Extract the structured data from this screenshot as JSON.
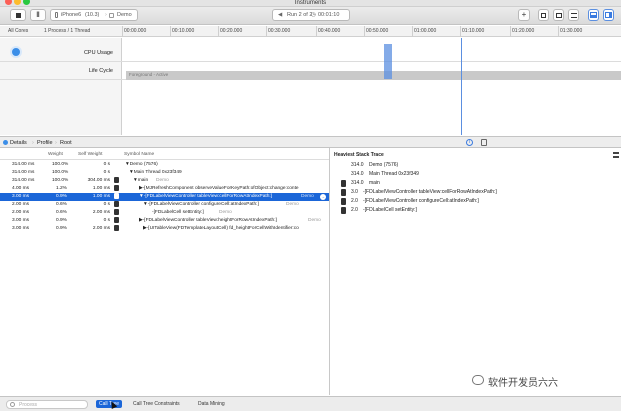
{
  "window": {
    "title": "Instruments"
  },
  "toolbar": {
    "device": "iPhone6",
    "device_version": "(10.3)",
    "target": "Demo",
    "run_label": "Run 2 of 2",
    "run_time": "00:01:10",
    "add_icon": "+"
  },
  "scope": {
    "cores": "All Cores",
    "processes": "1 Process / 1 Thread",
    "ticks": [
      "00:00.000",
      "00:10.000",
      "00:20.000",
      "00:30.000",
      "00:40.000",
      "00:50.000",
      "01:00.000",
      "01:10.000",
      "01:20.000",
      "01:30.000"
    ]
  },
  "tracks": {
    "cpu_label": "CPU Usage",
    "lifecycle_label": "Life Cycle",
    "lifecycle_bar_text": "Foreground - Active"
  },
  "detail": {
    "tab_details": "Details",
    "tab_profile": "Profile",
    "tab_root": "Root"
  },
  "calltree": {
    "headers": {
      "weight": "Weight",
      "self_weight": "Self Weight",
      "symbol": "Symbol Name"
    },
    "rows": [
      {
        "ms": "314.00 ms",
        "pct": "100.0%",
        "self": "0 s",
        "symbol": "▼Demo (7576)",
        "lib": "",
        "user": false,
        "indent": 0
      },
      {
        "ms": "314.00 ms",
        "pct": "100.0%",
        "self": "0 s",
        "symbol": "▼Main Thread  0x23f349",
        "lib": "",
        "user": false,
        "indent": 1
      },
      {
        "ms": "314.00 ms",
        "pct": "100.0%",
        "self": "304.00 ms",
        "symbol": "▼main",
        "lib": "Demo",
        "user": true,
        "indent": 2
      },
      {
        "ms": "4.00 ms",
        "pct": "1.2%",
        "self": "1.00 ms",
        "symbol": "▶-[MJRefreshComponent observeValueForKeyPath:ofObject:change:conte",
        "lib": "",
        "user": true,
        "indent": 3
      },
      {
        "ms": "3.00 ms",
        "pct": "0.9%",
        "self": "1.00 ms",
        "symbol": "▼-[FDLabelViewController tableView:cellForRowAtIndexPath:]",
        "lib": "Demo",
        "user": true,
        "indent": 3,
        "selected": true
      },
      {
        "ms": "2.00 ms",
        "pct": "0.6%",
        "self": "0 s",
        "symbol": "▼-[FDLabelViewController configureCell:atIndexPath:]",
        "lib": "Demo",
        "user": true,
        "indent": 4
      },
      {
        "ms": "2.00 ms",
        "pct": "0.6%",
        "self": "2.00 ms",
        "symbol": "-[FDLabelCell setEntity:]",
        "lib": "Demo",
        "user": true,
        "indent": 5
      },
      {
        "ms": "3.00 ms",
        "pct": "0.9%",
        "self": "0 s",
        "symbol": "▶-[FDLabelViewController tableView:heightForRowAtIndexPath:]",
        "lib": "Demo",
        "user": true,
        "indent": 3
      },
      {
        "ms": "3.00 ms",
        "pct": "0.9%",
        "self": "2.00 ms",
        "symbol": "▶-[UITableView(FDTemplateLayoutCell) fd_heightForCellWithIdentifier:co",
        "lib": "",
        "user": true,
        "indent": 3
      }
    ]
  },
  "heaviest": {
    "title": "Heaviest Stack Trace",
    "rows": [
      {
        "w": "314.0",
        "text": "Demo (7576)",
        "user": false
      },
      {
        "w": "314.0",
        "text": "Main Thread  0x23f349",
        "user": false
      },
      {
        "w": "314.0",
        "text": "main",
        "user": true
      },
      {
        "w": "3.0",
        "text": "-[FDLabelViewController tableView:cellForRowAtIndexPath:]",
        "user": true
      },
      {
        "w": "2.0",
        "text": "-[FDLabelViewController configureCell:atIndexPath:]",
        "user": true
      },
      {
        "w": "2.0",
        "text": "-[FDLabelCell setEntity:]",
        "user": true
      }
    ]
  },
  "bottom": {
    "search_placeholder": "Process",
    "tab_calltree": "Call Tree",
    "tab_constraints": "Call Tree Constraints",
    "tab_datamining": "Data Mining"
  },
  "watermark": {
    "text": "软件开发员六六"
  },
  "colors": {
    "selection": "#1b66d8",
    "playhead": "#5b8fe0",
    "lifecycle_bar": "#c9c9c9"
  }
}
